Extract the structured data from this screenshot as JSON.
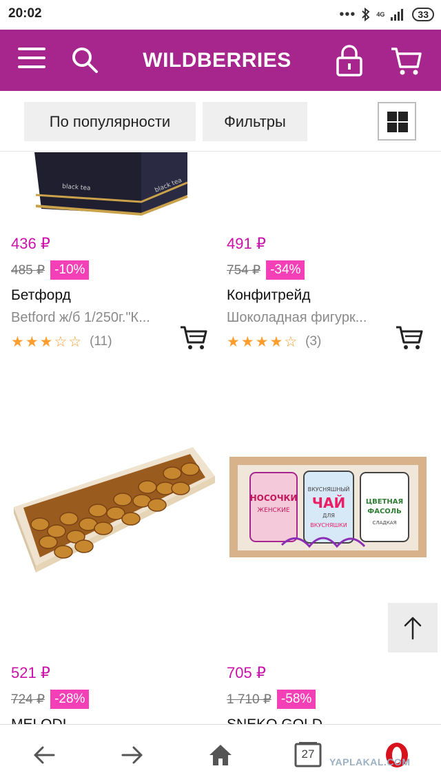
{
  "status_bar": {
    "time": "20:02",
    "network": "4G",
    "battery": "33"
  },
  "header": {
    "logo": "WILDBERRIES"
  },
  "toolbar": {
    "sort_label": "По популярности",
    "filter_label": "Фильтры"
  },
  "products": [
    {
      "price": "436 ₽",
      "old_price": "485 ₽",
      "discount": "-10%",
      "brand": "Бетфорд",
      "name": "Betford ж/б 1/250г.\"К...",
      "rating": 3,
      "reviews": "(11)",
      "image": "black-tea-tin"
    },
    {
      "price": "491 ₽",
      "old_price": "754 ₽",
      "discount": "-34%",
      "brand": "Конфитрейд",
      "name": "Шоколадная фигурк...",
      "rating": 4,
      "reviews": "(3)",
      "image": "white-background"
    },
    {
      "price": "521 ₽",
      "old_price": "724 ₽",
      "discount": "-28%",
      "brand": "MELODI",
      "name": "",
      "image": "glazed-nuts-box"
    },
    {
      "price": "705 ₽",
      "old_price": "1 710 ₽",
      "discount": "-58%",
      "brand": "SNEKO GOLD",
      "name": "",
      "image": "gift-box-three-jars",
      "jar_labels": [
        "НОСОЧКИ",
        "ЖЕНСКИЕ",
        "ВКУСНЯШНЫЙ",
        "ЧАЙ",
        "ДЛЯ",
        "ВКУСНЯШКИ",
        "ЦВЕТНАЯ",
        "ФАСОЛЬ",
        "СЛАДКАЯ"
      ]
    }
  ],
  "bottom_bar": {
    "tabs_count": "27"
  },
  "watermark": "YAPLAKAL.COM",
  "colors": {
    "brand": "#a6268d",
    "price": "#cb11ab",
    "discount_bg": "#f440b7",
    "star": "#ff9d2e"
  },
  "icons": [
    "menu-icon",
    "search-icon",
    "lock-icon",
    "cart-icon",
    "grid-view-icon",
    "add-to-cart-icon",
    "arrow-up-icon",
    "back-arrow-icon",
    "forward-arrow-icon",
    "home-icon",
    "tabs-icon",
    "opera-icon"
  ]
}
